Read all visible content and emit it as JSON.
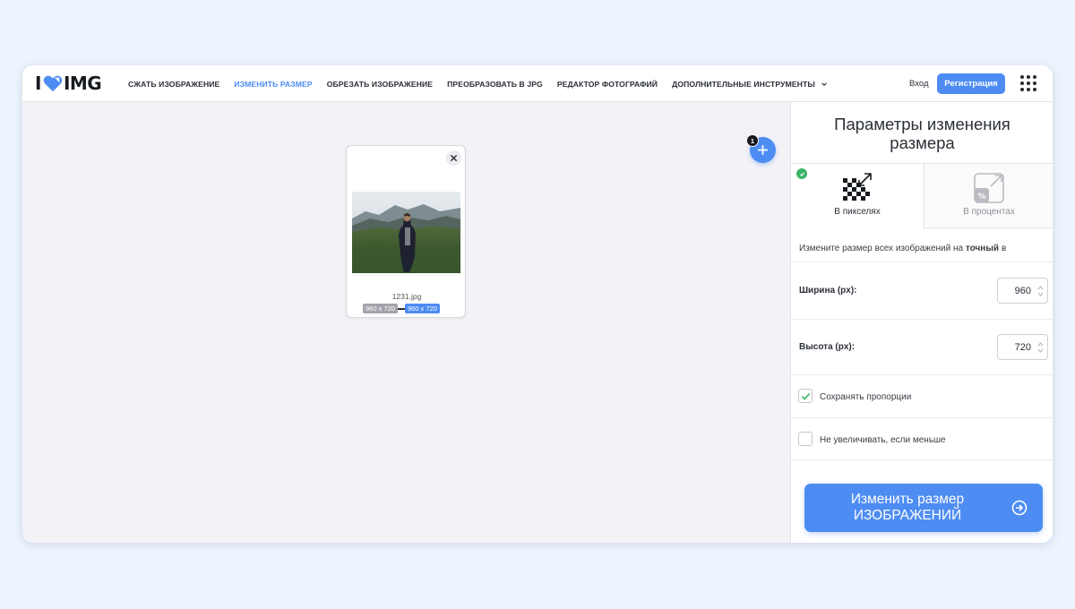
{
  "brand": {
    "prefix": "I",
    "suffix": "IMG"
  },
  "nav": [
    {
      "label": "СЖАТЬ ИЗОБРАЖЕНИЕ",
      "active": false
    },
    {
      "label": "ИЗМЕНИТЬ РАЗМЕР",
      "active": true
    },
    {
      "label": "ОБРЕЗАТЬ ИЗОБРАЖЕНИЕ",
      "active": false
    },
    {
      "label": "ПРЕОБРАЗОВАТЬ В JPG",
      "active": false
    },
    {
      "label": "РЕДАКТОР ФОТОГРАФИЙ",
      "active": false
    },
    {
      "label": "ДОПОЛНИТЕЛЬНЫЕ ИНСТРУМЕНТЫ",
      "active": false,
      "has_dropdown": true
    }
  ],
  "header": {
    "login_label": "Вход",
    "register_label": "Регистрация",
    "apps_icon": "grid-icon"
  },
  "file": {
    "name": "1231.jpg",
    "original_size": "960 x 720",
    "new_size": "960 x 720"
  },
  "add": {
    "count": "1"
  },
  "panel": {
    "title_line1": "Параметры изменения",
    "title_line2": "размера",
    "tabs": [
      {
        "label": "В пикселях",
        "icon": "pixels-resize-icon",
        "selected": true
      },
      {
        "label": "В процентах",
        "icon": "percent-resize-icon",
        "selected": false
      }
    ],
    "description_prefix": "Измените размер всех изображений на ",
    "description_bold": "точный",
    "description_suffix": " в",
    "width_label": "Ширина (px):",
    "width_value": "960",
    "height_label": "Высота (px):",
    "height_value": "720",
    "keep_ratio_label": "Сохранять пропорции",
    "keep_ratio_checked": true,
    "no_enlarge_label": "Не увеличивать, если меньше",
    "no_enlarge_checked": false,
    "submit_line1": "Изменить размер",
    "submit_line2": "ИЗОБРАЖЕНИЙ"
  },
  "colors": {
    "accent": "#4d8cf2",
    "success": "#3bb567",
    "background": "#edf4fd"
  }
}
